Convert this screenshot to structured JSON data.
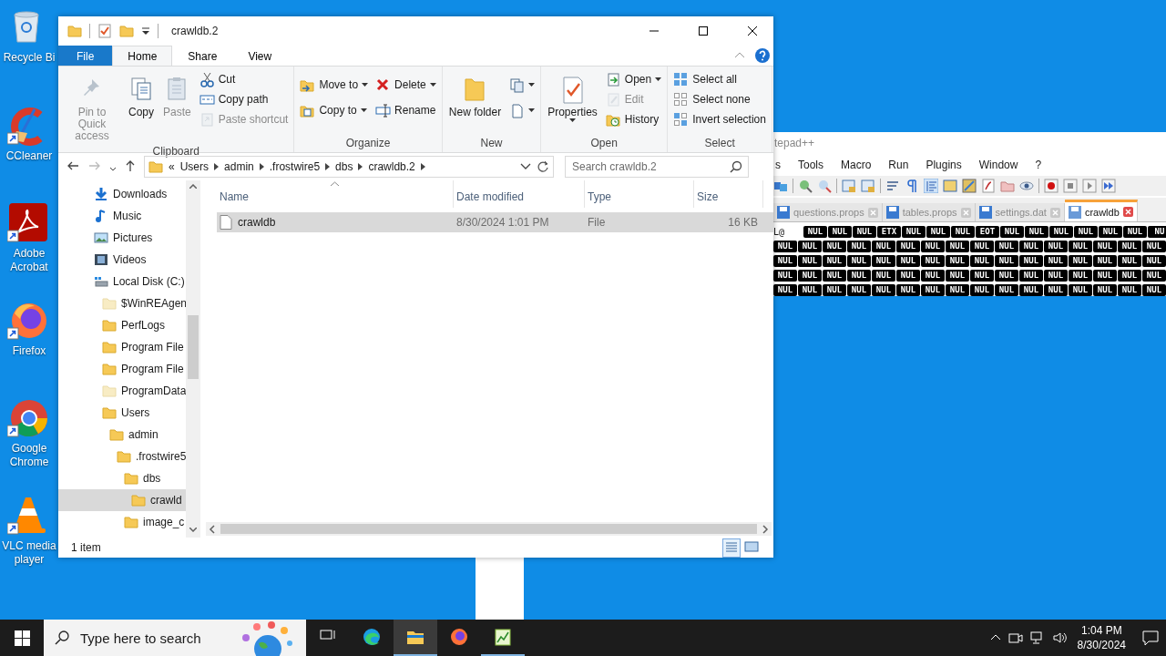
{
  "desktop_icons": [
    {
      "label": "Recycle Bi",
      "shortcut": false
    },
    {
      "label": "CCleaner",
      "shortcut": true
    },
    {
      "label": "Adobe Acrobat",
      "shortcut": true
    },
    {
      "label": "Firefox",
      "shortcut": true
    },
    {
      "label": "Google Chrome",
      "shortcut": true
    },
    {
      "label": "VLC media player",
      "shortcut": true
    }
  ],
  "notepad": {
    "title": "tepad++",
    "menu": [
      "s",
      "Tools",
      "Macro",
      "Run",
      "Plugins",
      "Window",
      "?"
    ],
    "tabs": [
      {
        "label": "questions.props",
        "selected": false
      },
      {
        "label": "tables.props",
        "selected": false
      },
      {
        "label": "settings.dat",
        "selected": false
      },
      {
        "label": "crawldb",
        "selected": true
      }
    ],
    "lines": [
      {
        "text": "L@",
        "controls": [
          "NUL",
          "NUL",
          "NUL",
          "ETX",
          "NUL",
          "NUL",
          "NUL",
          "EOT",
          "NUL",
          "NUL",
          "NUL",
          "NUL",
          "NUL",
          "NUL",
          "NU"
        ]
      },
      {
        "controls": [
          "NUL",
          "NUL",
          "NUL",
          "NUL",
          "NUL",
          "NUL",
          "NUL",
          "NUL",
          "NUL",
          "NUL",
          "NUL",
          "NUL",
          "NUL",
          "NUL",
          "NUL",
          "NUL"
        ]
      },
      {
        "controls": [
          "NUL",
          "NUL",
          "NUL",
          "NUL",
          "NUL",
          "NUL",
          "NUL",
          "NUL",
          "NUL",
          "NUL",
          "NUL",
          "NUL",
          "NUL",
          "NUL",
          "NUL",
          "NUL"
        ]
      },
      {
        "controls": [
          "NUL",
          "NUL",
          "NUL",
          "NUL",
          "NUL",
          "NUL",
          "NUL",
          "NUL",
          "NUL",
          "NUL",
          "NUL",
          "NUL",
          "NUL",
          "NUL",
          "NUL",
          "NUL"
        ]
      },
      {
        "controls": [
          "NUL",
          "NUL",
          "NUL",
          "NUL",
          "NUL",
          "NUL",
          "NUL",
          "NUL",
          "NUL",
          "NUL",
          "NUL",
          "NUL",
          "NUL",
          "NUL",
          "NUL",
          "NUL"
        ]
      }
    ]
  },
  "explorer": {
    "title": "crawldb.2",
    "tabs": [
      {
        "label": "File",
        "kind": "file",
        "selected": false
      },
      {
        "label": "Home",
        "kind": "tab",
        "selected": true
      },
      {
        "label": "Share",
        "kind": "tab",
        "selected": false
      },
      {
        "label": "View",
        "kind": "tab",
        "selected": false
      }
    ],
    "ribbon": [
      {
        "label": "Clipboard",
        "columns": [
          [
            {
              "label": "Pin to Quick access",
              "kind": "large",
              "disabled": true
            }
          ],
          [
            {
              "label": "Copy",
              "kind": "large",
              "disabled": false
            }
          ],
          [
            {
              "label": "Paste",
              "kind": "large",
              "disabled": true
            }
          ],
          [
            {
              "label": "Cut",
              "kind": "small",
              "disabled": false
            },
            {
              "label": "Copy path",
              "kind": "small",
              "disabled": false
            },
            {
              "label": "Paste shortcut",
              "kind": "small",
              "disabled": true
            }
          ]
        ]
      },
      {
        "label": "Organize",
        "columns": [
          [
            {
              "label": "Move to",
              "kind": "small",
              "disabled": false,
              "dropdown": true
            },
            {
              "label": "Copy to",
              "kind": "small",
              "disabled": false,
              "dropdown": true
            }
          ],
          [
            {
              "label": "Delete",
              "kind": "small",
              "disabled": false,
              "dropdown": true
            },
            {
              "label": "Rename",
              "kind": "small",
              "disabled": false
            }
          ]
        ]
      },
      {
        "label": "New",
        "columns": [
          [
            {
              "label": "New folder",
              "kind": "large",
              "disabled": false
            }
          ],
          [
            {
              "kind": "small",
              "disabled": false,
              "dropdown": true
            },
            {
              "kind": "small",
              "disabled": false,
              "dropdown": true
            }
          ]
        ]
      },
      {
        "label": "Open",
        "columns": [
          [
            {
              "label": "Properties",
              "kind": "large",
              "disabled": false,
              "dropdown": true
            }
          ],
          [
            {
              "label": "Open",
              "kind": "small",
              "disabled": false,
              "dropdown": true
            },
            {
              "label": "Edit",
              "kind": "small",
              "disabled": true
            },
            {
              "label": "History",
              "kind": "small",
              "disabled": false
            }
          ]
        ]
      },
      {
        "label": "Select",
        "columns": [
          [
            {
              "label": "Select all",
              "kind": "small",
              "disabled": false
            },
            {
              "label": "Select none",
              "kind": "small",
              "disabled": false
            },
            {
              "label": "Invert selection",
              "kind": "small",
              "disabled": false
            }
          ]
        ]
      }
    ],
    "address": {
      "overflow": "«",
      "crumbs": [
        "Users",
        "admin",
        ".frostwire5",
        "dbs",
        "crawldb.2"
      ]
    },
    "search": {
      "placeholder": "Search crawldb.2"
    },
    "nav": [
      {
        "label": "Downloads"
      },
      {
        "label": "Music"
      },
      {
        "label": "Pictures"
      },
      {
        "label": "Videos"
      },
      {
        "label": "Local Disk (C:)",
        "children": [
          {
            "label": "$WinREAgen",
            "hidden": true,
            "selected": false
          },
          {
            "label": "PerfLogs",
            "hidden": false,
            "selected": false
          },
          {
            "label": "Program File",
            "hidden": false,
            "selected": false
          },
          {
            "label": "Program File",
            "hidden": false,
            "selected": false
          },
          {
            "label": "ProgramData",
            "hidden": true,
            "selected": false
          },
          {
            "label": "Users",
            "hidden": false,
            "selected": false,
            "children": [
              {
                "label": "admin",
                "hidden": false,
                "selected": false,
                "children": [
                  {
                    "label": ".frostwire5",
                    "hidden": false,
                    "selected": false,
                    "children": [
                      {
                        "label": "dbs",
                        "hidden": false,
                        "selected": false,
                        "children": [
                          {
                            "label": "crawld",
                            "hidden": false,
                            "selected": true
                          }
                        ]
                      },
                      {
                        "label": "image_c",
                        "hidden": false,
                        "selected": false
                      }
                    ]
                  }
                ]
              }
            ]
          }
        ]
      }
    ],
    "columns": [
      {
        "label": "Name",
        "sorted": true
      },
      {
        "label": "Date modified",
        "sorted": false
      },
      {
        "label": "Type",
        "sorted": false
      },
      {
        "label": "Size",
        "sorted": false
      }
    ],
    "rows": [
      {
        "cells": [
          "crawldb",
          "8/30/2024 1:01 PM",
          "File",
          "16 KB"
        ],
        "selected": true
      }
    ],
    "status_bar": {
      "item_count": "1 item",
      "views": [
        {
          "selected": true
        },
        {
          "selected": false
        }
      ]
    }
  },
  "taskbar": {
    "search": {
      "placeholder": "Type here to search"
    },
    "apps": [
      {
        "selected": false,
        "running": false
      },
      {
        "selected": false,
        "running": false
      },
      {
        "selected": true,
        "running": true
      },
      {
        "selected": false,
        "running": false
      },
      {
        "selected": false,
        "running": true
      }
    ],
    "time": "1:04 PM",
    "date": "8/30/2024"
  }
}
